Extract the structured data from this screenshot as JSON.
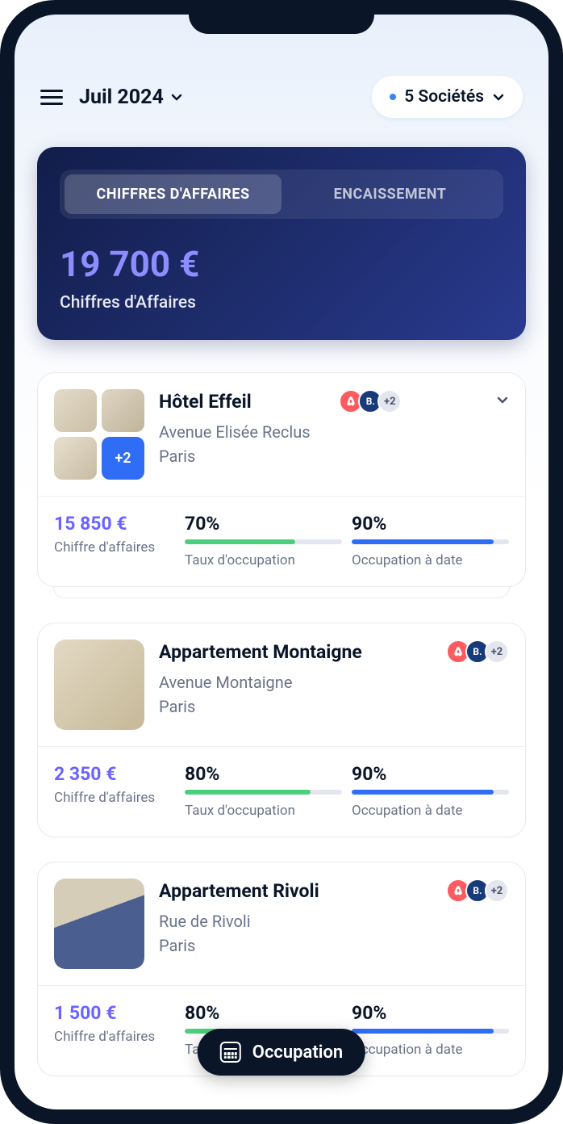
{
  "header": {
    "month": "Juil 2024",
    "filter": "5 Sociétés"
  },
  "hero": {
    "tab_revenue": "CHIFFRES D'AFFAIRES",
    "tab_cash": "ENCAISSEMENT",
    "amount": "19 700 €",
    "subtitle": "Chiffres d'Affaires"
  },
  "labels": {
    "revenue": "Chiffre d'affaires",
    "occupancy_rate": "Taux d'occupation",
    "occupancy_todate": "Occupation à date",
    "more_thumbs": "+2",
    "more_badges": "+2",
    "booking_char": "B."
  },
  "floating": "Occupation",
  "properties": [
    {
      "title": "Hôtel Effeil",
      "addr_line1": "Avenue Elisée Reclus",
      "addr_line2": "Paris",
      "revenue": "15 850 €",
      "occ_rate": "70%",
      "occ_rate_pct": 70,
      "occ_todate": "90%",
      "occ_todate_pct": 90,
      "multi_thumbs": true,
      "expandable": true
    },
    {
      "title": "Appartement Montaigne",
      "addr_line1": "Avenue Montaigne",
      "addr_line2": "Paris",
      "revenue": "2 350 €",
      "occ_rate": "80%",
      "occ_rate_pct": 80,
      "occ_todate": "90%",
      "occ_todate_pct": 90,
      "multi_thumbs": false,
      "expandable": false
    },
    {
      "title": "Appartement Rivoli",
      "addr_line1": "Rue de Rivoli",
      "addr_line2": "Paris",
      "revenue": "1 500 €",
      "occ_rate": "80%",
      "occ_rate_pct": 80,
      "occ_todate": "90%",
      "occ_todate_pct": 90,
      "multi_thumbs": false,
      "expandable": false
    }
  ]
}
